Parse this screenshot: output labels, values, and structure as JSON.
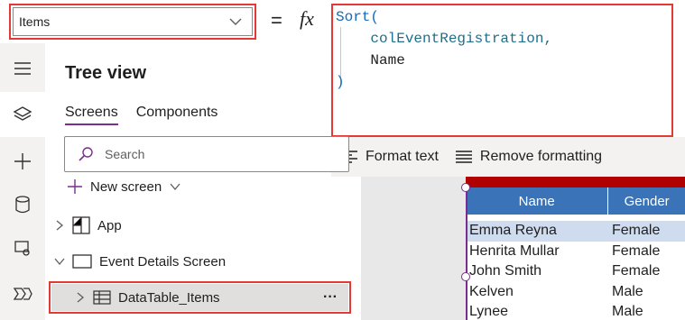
{
  "formula_bar": {
    "property": "Items",
    "equals": "=",
    "fx": "fx",
    "formula_lines": [
      "Sort(",
      "    colEventRegistration,",
      "    Name",
      ")"
    ]
  },
  "format_bar": {
    "format_text": "Format text",
    "remove_formatting": "Remove formatting"
  },
  "left_rail": {
    "items": [
      "menu-icon",
      "layers-icon",
      "plus-icon",
      "database-icon",
      "media-icon",
      "power-automate-icon"
    ]
  },
  "tree_view": {
    "title": "Tree view",
    "tabs": [
      "Screens",
      "Components"
    ],
    "search_placeholder": "Search",
    "new_screen": "New screen",
    "app": "App",
    "screen": "Event Details Screen",
    "control": "DataTable_Items",
    "more": "···"
  },
  "data_table": {
    "columns": [
      "Name",
      "Gender"
    ],
    "rows": [
      [
        "Emma Reyna",
        "Female"
      ],
      [
        "Henrita Mullar",
        "Female"
      ],
      [
        "John Smith",
        "Female"
      ],
      [
        "Kelven",
        "Male"
      ],
      [
        "Lynee",
        "Male"
      ]
    ],
    "colors": {
      "header": "#3b73b9",
      "topbar": "#b00000",
      "selected": "#cfdcf0"
    }
  },
  "colors": {
    "highlight": "#e53935",
    "accent": "#7a2d8f"
  }
}
